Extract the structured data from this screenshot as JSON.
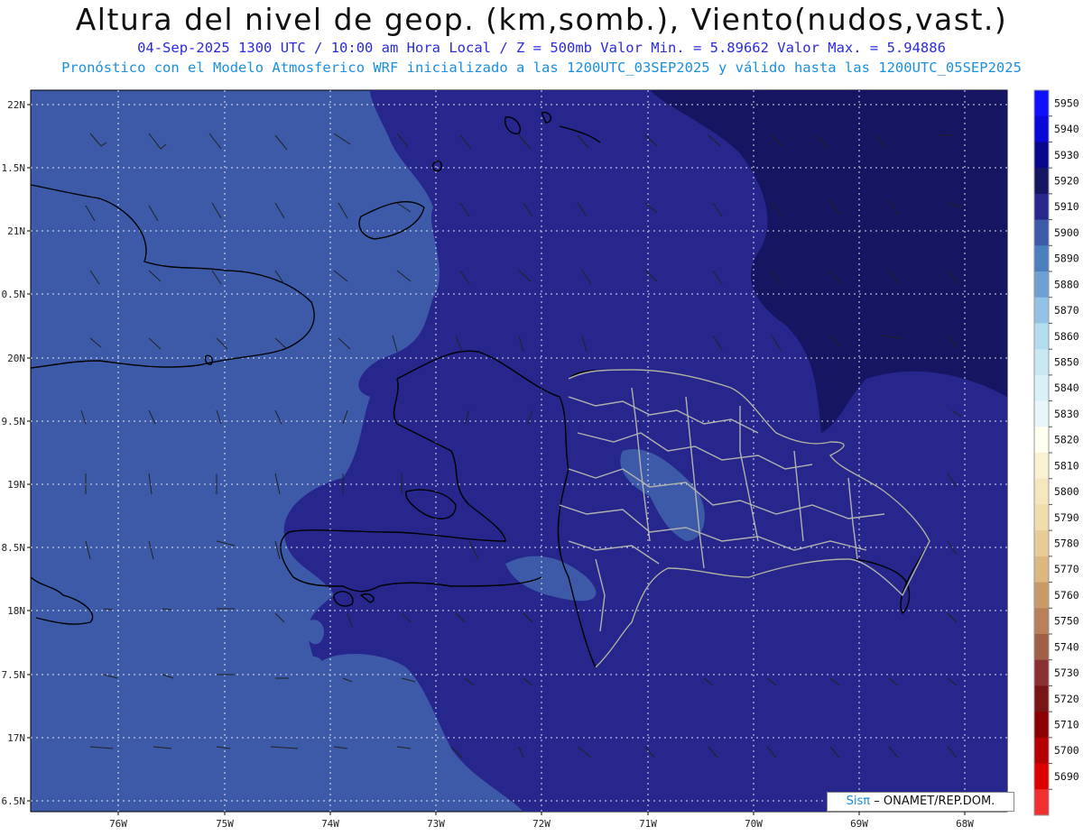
{
  "title": "Altura del nivel de geop. (km,somb.), Viento(nudos,vast.)",
  "subtitle_1": "04-Sep-2025  1300 UTC / 10:00 am Hora Local / Z = 500mb    Valor Min. = 5.89662  Valor Max. = 5.94886",
  "subtitle_2": "Pronóstico con el Modelo Atmosferico WRF inicializado a las 1200UTC_03SEP2025 y válido hasta las  1200UTC_05SEP2025",
  "lat_labels": [
    "22N",
    "1.5N",
    "21N",
    "0.5N",
    "20N",
    "9.5N",
    "19N",
    "8.5N",
    "18N",
    "7.5N",
    "17N",
    "6.5N"
  ],
  "lon_labels": [
    "76W",
    "75W",
    "74W",
    "73W",
    "72W",
    "71W",
    "70W",
    "69W",
    "68W"
  ],
  "colorbar": {
    "labels": [
      "5950",
      "5940",
      "5930",
      "5920",
      "5910",
      "5900",
      "5890",
      "5880",
      "5870",
      "5860",
      "5850",
      "5840",
      "5830",
      "5820",
      "5810",
      "5800",
      "5790",
      "5780",
      "5770",
      "5760",
      "5750",
      "5740",
      "5730",
      "5720",
      "5710",
      "5700",
      "5690"
    ],
    "colors": [
      "#1010ff",
      "#0808d8",
      "#08088c",
      "#151561",
      "#26268c",
      "#3c5aa8",
      "#4b7fbe",
      "#6ea0d2",
      "#94c2e4",
      "#b4dcf0",
      "#c8e8f4",
      "#d8f0f8",
      "#e6f6fa",
      "#fffff0",
      "#faf0d2",
      "#f5e6be",
      "#f0dcac",
      "#e8cc98",
      "#dcb880",
      "#c89a68",
      "#b8805a",
      "#a06048",
      "#8a3030",
      "#781414",
      "#8c0000",
      "#b40000",
      "#dc0000",
      "#f03030"
    ]
  },
  "credit": {
    "sis": "Sisπ",
    "rest": "– ONAMET/REP.DOM."
  }
}
